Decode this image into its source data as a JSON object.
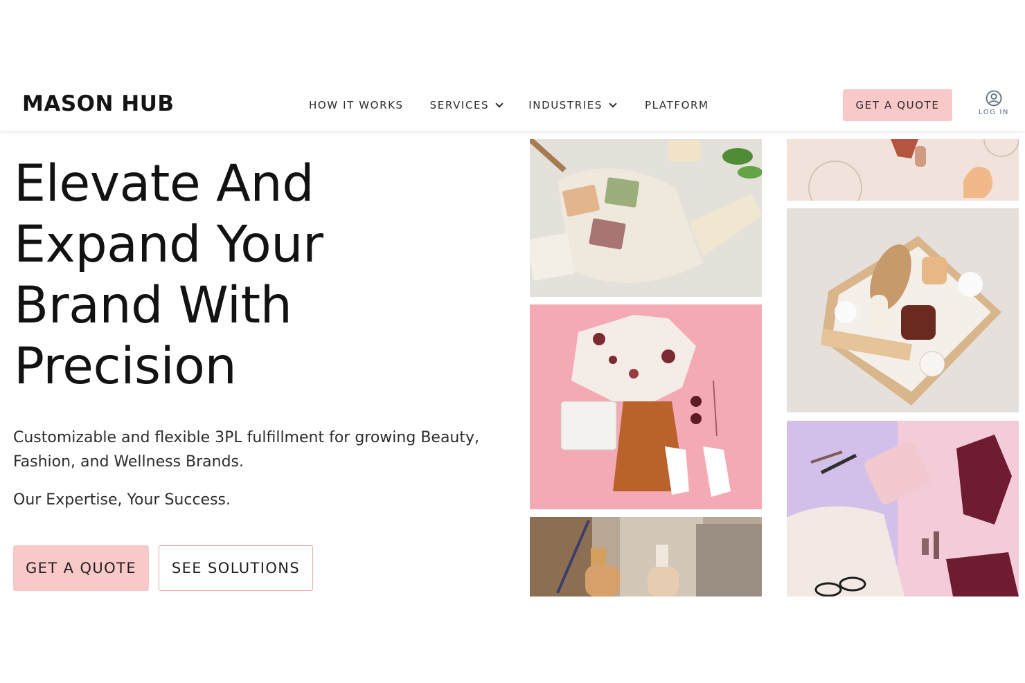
{
  "header": {
    "logo": "MASON HUB",
    "nav": [
      {
        "label": "HOW IT WORKS",
        "has_dropdown": false
      },
      {
        "label": "SERVICES",
        "has_dropdown": true
      },
      {
        "label": "INDUSTRIES",
        "has_dropdown": true
      },
      {
        "label": "PLATFORM",
        "has_dropdown": false
      }
    ],
    "quote_button": "GET A QUOTE",
    "login_label": "LOG IN"
  },
  "hero": {
    "title_lines": [
      "Elevate And",
      "Expand Your",
      "Brand With",
      "Precision"
    ],
    "subtitle": "Customizable and flexible 3PL fulfillment for growing Beauty, Fashion, and Wellness Brands.",
    "tagline": "Our Expertise, Your Success.",
    "primary_button": "GET A QUOTE",
    "secondary_button": "SEE SOLUTIONS"
  },
  "gallery": [
    {
      "name": "soap-bars-photo"
    },
    {
      "name": "fashion-flatlay-photo"
    },
    {
      "name": "serum-bottles-photo"
    },
    {
      "name": "makeup-sponge-photo"
    },
    {
      "name": "spa-gift-box-photo"
    },
    {
      "name": "beauty-accessories-photo"
    }
  ],
  "colors": {
    "accent": "#f9c8c9",
    "accent_border": "#f0a3a6",
    "text": "#121212",
    "login_icon": "#5a6d80"
  }
}
